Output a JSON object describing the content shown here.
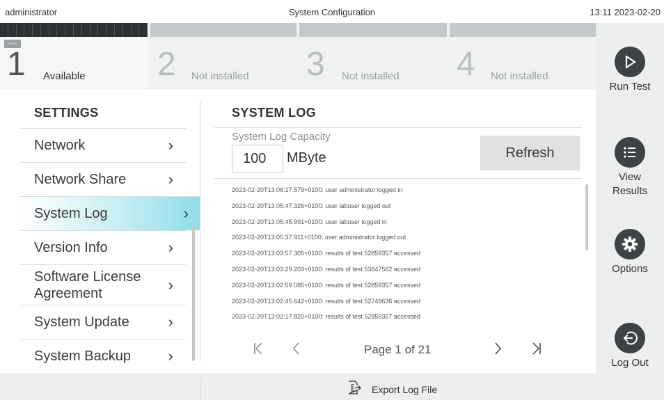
{
  "topbar": {
    "user": "administrator",
    "title": "System Configuration",
    "datetime": "13:11 2023-02-20"
  },
  "modules": [
    {
      "number": "1",
      "status": "Available",
      "badge": "--:--"
    },
    {
      "number": "2",
      "status": "Not installed"
    },
    {
      "number": "3",
      "status": "Not installed"
    },
    {
      "number": "4",
      "status": "Not installed"
    }
  ],
  "rightbar": {
    "run_test": "Run Test",
    "view_results": "View Results",
    "options": "Options",
    "log_out": "Log Out"
  },
  "settings": {
    "header": "SETTINGS",
    "items": [
      {
        "label": "Network"
      },
      {
        "label": "Network Share"
      },
      {
        "label": "System Log",
        "active": true
      },
      {
        "label": "Version Info"
      },
      {
        "label": "Software License Agreement"
      },
      {
        "label": "System Update"
      },
      {
        "label": "System Backup"
      }
    ]
  },
  "system_log": {
    "title": "SYSTEM LOG",
    "capacity_label": "System Log Capacity",
    "capacity_value": "100",
    "capacity_unit": "MByte",
    "refresh_label": "Refresh",
    "entries": [
      "2023-02-20T13:06:17.579+0100: user administrator logged in",
      "2023-02-20T13:05:47.326+0100: user labuser logged out",
      "2023-02-20T13:05:45.991+0100: user labuser logged in",
      "2023-02-20T13:05:37.911+0100: user administrator logged out",
      "2023-02-20T13:03:57.305+0100: results of test 52859357 accessed",
      "2023-02-20T13:03:29.203+0100: results of test 53647562 accessed",
      "2023-02-20T13:02:59.085+0100: results of test 52859357 accessed",
      "2023-02-20T13:02:45.642+0100: results of test 52749636 accessed",
      "2023-02-20T13:02:17.820+0100: results of test 52859357 accessed"
    ],
    "pagination": "Page 1 of 21"
  },
  "bottombar": {
    "export_label": "Export Log File"
  },
  "colors": {
    "accent_active": "#8fdde7",
    "icon_bg": "#3d4246"
  }
}
